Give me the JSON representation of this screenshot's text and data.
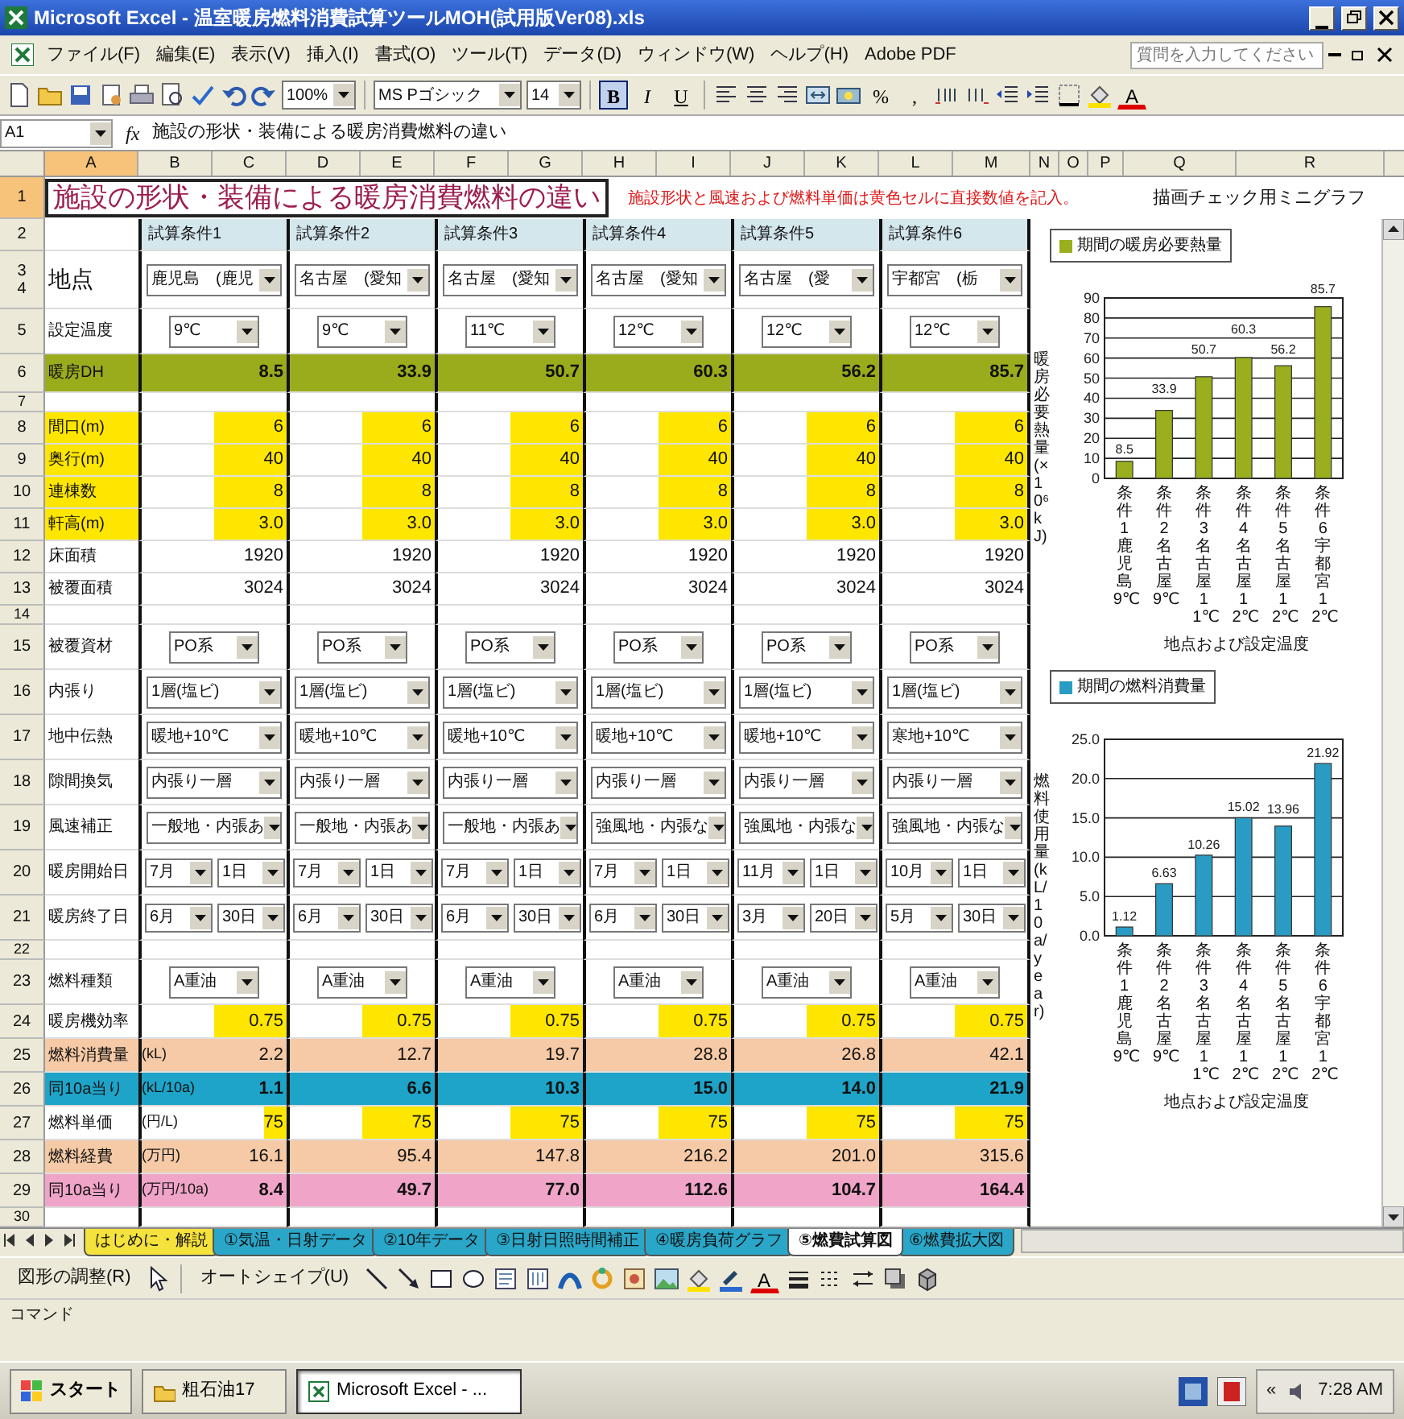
{
  "window": {
    "title": "Microsoft Excel - 温室暖房燃料消費試算ツールMOH(試用版Ver08).xls"
  },
  "menu": [
    "ファイル(F)",
    "編集(E)",
    "表示(V)",
    "挿入(I)",
    "書式(O)",
    "ツール(T)",
    "データ(D)",
    "ウィンドウ(W)",
    "ヘルプ(H)",
    "Adobe PDF"
  ],
  "help_search": {
    "placeholder": "質問を入力してください"
  },
  "toolbar": {
    "zoom": "100%",
    "font": "MS Pゴシック",
    "size": "14",
    "percent": "%",
    "comma": ",",
    "font_color": "A"
  },
  "format_buttons": [
    {
      "label": "B",
      "selected": true
    },
    {
      "label": "I",
      "selected": false
    },
    {
      "label": "U",
      "selected": false
    }
  ],
  "formula_bar": {
    "cell": "A1",
    "fx": "fx",
    "formula": "施設の形状・装備による暖房消費燃料の違い"
  },
  "columns": [
    {
      "label": "A",
      "selected": true
    },
    {
      "label": "B",
      "selected": false
    },
    {
      "label": "C",
      "selected": false
    },
    {
      "label": "D",
      "selected": false
    },
    {
      "label": "E",
      "selected": false
    },
    {
      "label": "F",
      "selected": false
    },
    {
      "label": "G",
      "selected": false
    },
    {
      "label": "H",
      "selected": false
    },
    {
      "label": "I",
      "selected": false
    },
    {
      "label": "J",
      "selected": false
    },
    {
      "label": "K",
      "selected": false
    },
    {
      "label": "L",
      "selected": false
    },
    {
      "label": "M",
      "selected": false
    },
    {
      "label": "N",
      "selected": false
    },
    {
      "label": "O",
      "selected": false
    },
    {
      "label": "P",
      "selected": false
    },
    {
      "label": "Q",
      "selected": false
    },
    {
      "label": "R",
      "selected": false
    }
  ],
  "title_row": {
    "num": "1",
    "selected": true,
    "title": "施設の形状・装備による暖房消費燃料の違い",
    "note": "施設形状と風速および燃料単価は黄色セルに直接数値を記入。",
    "chart_caption": "描画チェック用ミニグラフ"
  },
  "rows": [
    {
      "nums": [
        "2"
      ],
      "kind": "header",
      "values": [
        "試算条件1",
        "試算条件2",
        "試算条件3",
        "試算条件4",
        "試算条件5",
        "試算条件6"
      ]
    },
    {
      "nums": [
        "3",
        "4"
      ],
      "label": "地点",
      "kind": "select",
      "values": [
        "鹿児島　(鹿児",
        "名古屋　(愛知",
        "名古屋　(愛知",
        "名古屋　(愛知",
        "名古屋　(愛",
        "宇都宮　(栃"
      ]
    },
    {
      "nums": [
        "5"
      ],
      "label": "設定温度",
      "kind": "select_small",
      "values": [
        "9℃",
        "9℃",
        "11℃",
        "12℃",
        "12℃",
        "12℃"
      ]
    },
    {
      "nums": [
        "6"
      ],
      "label": "暖房DH",
      "kind": "heat",
      "values": [
        "8.5",
        "33.9",
        "50.7",
        "60.3",
        "56.2",
        "85.7"
      ]
    },
    {
      "nums": [
        "7"
      ],
      "kind": "blank"
    },
    {
      "nums": [
        "8"
      ],
      "label": "間口(m)",
      "kind": "input",
      "values": [
        "6",
        "6",
        "6",
        "6",
        "6",
        "6"
      ]
    },
    {
      "nums": [
        "9"
      ],
      "label": "奥行(m)",
      "kind": "input",
      "values": [
        "40",
        "40",
        "40",
        "40",
        "40",
        "40"
      ]
    },
    {
      "nums": [
        "10"
      ],
      "label": "連棟数",
      "kind": "input",
      "values": [
        "8",
        "8",
        "8",
        "8",
        "8",
        "8"
      ]
    },
    {
      "nums": [
        "11"
      ],
      "label": "軒高(m)",
      "kind": "input",
      "values": [
        "3.0",
        "3.0",
        "3.0",
        "3.0",
        "3.0",
        "3.0"
      ]
    },
    {
      "nums": [
        "12"
      ],
      "label": "床面積",
      "kind": "plain",
      "values": [
        "1920",
        "1920",
        "1920",
        "1920",
        "1920",
        "1920"
      ]
    },
    {
      "nums": [
        "13"
      ],
      "label": "被覆面積",
      "kind": "plain",
      "values": [
        "3024",
        "3024",
        "3024",
        "3024",
        "3024",
        "3024"
      ]
    },
    {
      "nums": [
        "14"
      ],
      "kind": "blank"
    },
    {
      "nums": [
        "15"
      ],
      "label": "被覆資材",
      "kind": "select_small",
      "values": [
        "PO系",
        "PO系",
        "PO系",
        "PO系",
        "PO系",
        "PO系"
      ]
    },
    {
      "nums": [
        "16"
      ],
      "label": "内張り",
      "kind": "select",
      "values": [
        "1層(塩ビ)",
        "1層(塩ビ)",
        "1層(塩ビ)",
        "1層(塩ビ)",
        "1層(塩ビ)",
        "1層(塩ビ)"
      ]
    },
    {
      "nums": [
        "17"
      ],
      "label": "地中伝熱",
      "kind": "select",
      "values": [
        "暖地+10℃",
        "暖地+10℃",
        "暖地+10℃",
        "暖地+10℃",
        "暖地+10℃",
        "寒地+10℃"
      ]
    },
    {
      "nums": [
        "18"
      ],
      "label": "隙間換気",
      "kind": "select",
      "values": [
        "内張り一層",
        "内張り一層",
        "内張り一層",
        "内張り一層",
        "内張り一層",
        "内張り一層"
      ]
    },
    {
      "nums": [
        "19"
      ],
      "label": "風速補正",
      "kind": "select",
      "values": [
        "一般地・内張あ",
        "一般地・内張あ",
        "一般地・内張あ",
        "強風地・内張な",
        "強風地・内張な",
        "強風地・内張な"
      ]
    },
    {
      "nums": [
        "20"
      ],
      "label": "暖房開始日",
      "kind": "date",
      "values": [
        [
          "7月",
          "1日"
        ],
        [
          "7月",
          "1日"
        ],
        [
          "7月",
          "1日"
        ],
        [
          "7月",
          "1日"
        ],
        [
          "11月",
          "1日"
        ],
        [
          "10月",
          "1日"
        ]
      ]
    },
    {
      "nums": [
        "21"
      ],
      "label": "暖房終了日",
      "kind": "date",
      "values": [
        [
          "6月",
          "30日"
        ],
        [
          "6月",
          "30日"
        ],
        [
          "6月",
          "30日"
        ],
        [
          "6月",
          "30日"
        ],
        [
          "3月",
          "20日"
        ],
        [
          "5月",
          "30日"
        ]
      ]
    },
    {
      "nums": [
        "22"
      ],
      "kind": "blank"
    },
    {
      "nums": [
        "23"
      ],
      "label": "燃料種類",
      "kind": "select_small",
      "values": [
        "A重油",
        "A重油",
        "A重油",
        "A重油",
        "A重油",
        "A重油"
      ]
    },
    {
      "nums": [
        "24"
      ],
      "label": "暖房機効率",
      "kind": "entry",
      "values": [
        "0.75",
        "0.75",
        "0.75",
        "0.75",
        "0.75",
        "0.75"
      ]
    },
    {
      "nums": [
        "25"
      ],
      "label": "燃料消費量",
      "unit": "(kL)",
      "kind": "orange",
      "values": [
        "2.2",
        "12.7",
        "19.7",
        "28.8",
        "26.8",
        "42.1"
      ]
    },
    {
      "nums": [
        "26"
      ],
      "label": "同10a当り",
      "unit": "(kL/10a)",
      "kind": "blue",
      "values": [
        "1.1",
        "6.6",
        "10.3",
        "15.0",
        "14.0",
        "21.9"
      ]
    },
    {
      "nums": [
        "27"
      ],
      "label": "燃料単価",
      "unit": "(円/L)",
      "kind": "entry",
      "values": [
        "75",
        "75",
        "75",
        "75",
        "75",
        "75"
      ]
    },
    {
      "nums": [
        "28"
      ],
      "label": "燃料経費",
      "unit": "(万円)",
      "kind": "orange",
      "values": [
        "16.1",
        "95.4",
        "147.8",
        "216.2",
        "201.0",
        "315.6"
      ]
    },
    {
      "nums": [
        "29"
      ],
      "label": "同10a当り",
      "unit": "(万円/10a)",
      "kind": "pink",
      "values": [
        "8.4",
        "49.7",
        "77.0",
        "112.6",
        "104.7",
        "164.4"
      ]
    },
    {
      "nums": [
        "30"
      ],
      "kind": "blank"
    }
  ],
  "charts": [
    {
      "chart_data": {
        "type": "bar",
        "xlabel": "地点および設定温度",
        "ylabel": "暖房必要熱量(×10⁶kJ)",
        "categories": [
          "条件1鹿児島9℃",
          "条件2名古屋9℃",
          "条件3名古屋11℃",
          "条件4名古屋12℃",
          "条件5名古屋12℃",
          "条件6宇都宮12℃"
        ],
        "series": [
          {
            "name": "期間の暖房必要熱量",
            "color": "#9aae1e",
            "values": [
              8.5,
              33.9,
              50.7,
              60.3,
              56.2,
              85.7
            ]
          }
        ],
        "grid": true,
        "ylim": [
          0,
          90
        ],
        "yticks": [
          0,
          10,
          20,
          30,
          40,
          50,
          60,
          70,
          80,
          90
        ],
        "value_labels": [
          "8.5",
          "33.9",
          "50.7",
          "60.3",
          "56.2",
          "85.7"
        ]
      }
    },
    {
      "chart_data": {
        "type": "bar",
        "xlabel": "地点および設定温度",
        "ylabel": "燃料使用量(kL/10a/year)",
        "categories": [
          "条件1鹿児島9℃",
          "条件2名古屋9℃",
          "条件3名古屋11℃",
          "条件4名古屋12℃",
          "条件5名古屋12℃",
          "条件6宇都宮12℃"
        ],
        "series": [
          {
            "name": "期間の燃料消費量",
            "color": "#2a9cc4",
            "values": [
              1.12,
              6.63,
              10.26,
              15.02,
              13.96,
              21.92
            ]
          }
        ],
        "grid": true,
        "ylim": [
          0,
          25
        ],
        "yticks": [
          {
            "value": 0,
            "label": "0.0"
          },
          {
            "value": 5,
            "label": "5.0"
          },
          {
            "value": 10,
            "label": "10.0"
          },
          {
            "value": 15,
            "label": "15.0"
          },
          {
            "value": 20,
            "label": "20.0"
          },
          {
            "value": 25,
            "label": "25.0"
          }
        ],
        "value_labels": [
          "1.12",
          "6.63",
          "10.26",
          "15.02",
          "13.96",
          "21.92"
        ]
      }
    }
  ],
  "sheet_tabs": [
    {
      "label": "はじめに・解説",
      "selected": false,
      "color": "#f5e23c"
    },
    {
      "label": "①気温・日射データ",
      "selected": false,
      "color": "#2aa6c8"
    },
    {
      "label": "②10年データ",
      "selected": false,
      "color": "#2aa6c8"
    },
    {
      "label": "③日射日照時間補正",
      "selected": false,
      "color": "#2aa6c8"
    },
    {
      "label": "④暖房負荷グラフ",
      "selected": false,
      "color": "#2aa6c8"
    },
    {
      "label": "⑤燃費試算図",
      "selected": true,
      "color": "#ffffff"
    },
    {
      "label": "⑥燃費拡大図",
      "selected": false,
      "color": "#2aa6c8"
    }
  ],
  "drawing_toolbar": {
    "adjust": "図形の調整(R)",
    "autoshape": "オートシェイプ(U)",
    "font_color": "A"
  },
  "status_bar": "コマンド",
  "taskbar": {
    "start": "スタート",
    "buttons": [
      {
        "label": "粗石油17",
        "kind": "folder",
        "selected": false
      },
      {
        "label": "Microsoft Excel - ...",
        "kind": "excel",
        "selected": true
      }
    ],
    "expand": "«",
    "clock": "7:28 AM"
  }
}
